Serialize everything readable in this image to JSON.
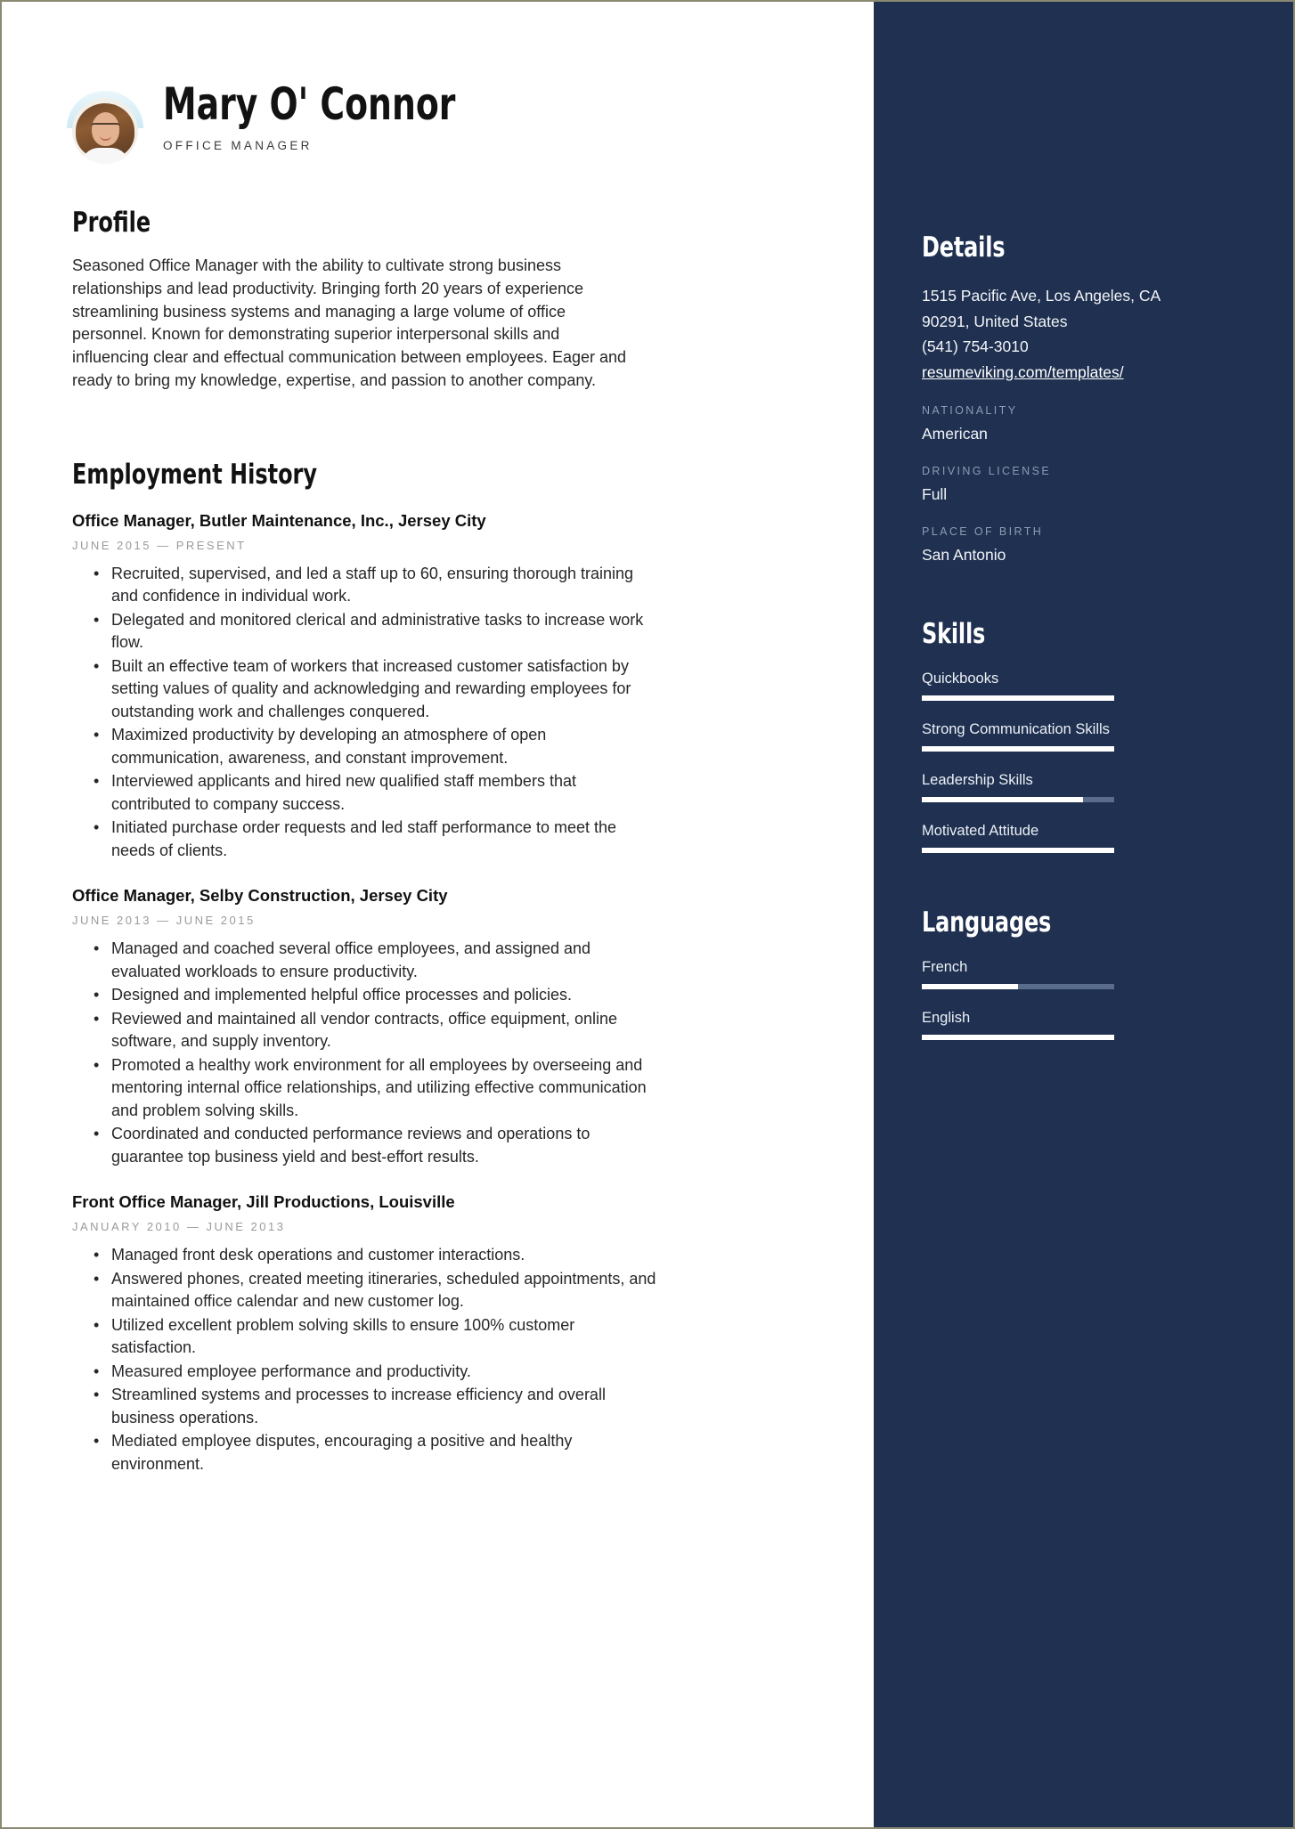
{
  "colors": {
    "sidebar_bg": "#1f3050",
    "accent_text": "#ffffff",
    "bar_track": "#5a6c8c",
    "muted_label": "#8d9bb3",
    "date_text": "#9a9a9a",
    "page_border": "#8a8a72"
  },
  "header": {
    "name": "Mary O' Connor",
    "role": "OFFICE MANAGER",
    "avatar_alt": "portrait-photo"
  },
  "profile": {
    "heading": "Profile",
    "text": "Seasoned Office Manager with the ability to cultivate strong business relationships and lead productivity. Bringing forth 20 years of experience streamlining business systems and managing a large volume of office personnel. Known for demonstrating superior interpersonal skills and influencing clear and effectual communication between employees.  Eager and ready to bring my knowledge, expertise, and passion to another company."
  },
  "employment": {
    "heading": "Employment History",
    "jobs": [
      {
        "title": "Office Manager, Butler Maintenance, Inc., Jersey City",
        "date": "JUNE 2015 — PRESENT",
        "bullets": [
          "Recruited, supervised, and led a staff up to 60, ensuring thorough training and confidence in individual work.",
          "Delegated and monitored clerical and administrative tasks to increase work flow.",
          "Built an effective team of workers that increased customer satisfaction by setting values of quality and acknowledging and rewarding employees for outstanding work and challenges conquered.",
          "Maximized productivity by developing an atmosphere of open communication, awareness, and constant improvement.",
          "Interviewed applicants and hired new qualified staff members that contributed to company success.",
          "Initiated purchase order requests and led staff performance to meet the needs of clients."
        ]
      },
      {
        "title": "Office Manager, Selby Construction, Jersey City",
        "date": "JUNE 2013 — JUNE 2015",
        "bullets": [
          "Managed and coached several office employees, and assigned and evaluated workloads to ensure productivity.",
          " Designed and implemented helpful office processes and policies.",
          "Reviewed and maintained all vendor contracts, office equipment, online software, and supply inventory.",
          "Promoted a healthy work environment for all employees by overseeing and mentoring internal office relationships, and utilizing effective communication and problem solving skills.",
          "Coordinated and conducted performance reviews and operations to guarantee top business yield and best-effort results."
        ]
      },
      {
        "title": "Front Office Manager, Jill Productions, Louisville",
        "date": "JANUARY 2010 — JUNE 2013",
        "bullets": [
          "Managed front desk operations and customer interactions.",
          "Answered phones, created meeting itineraries, scheduled appointments, and maintained office calendar and new customer log.",
          "Utilized excellent problem solving skills to ensure 100% customer satisfaction.",
          "Measured employee performance and productivity.",
          "Streamlined systems and processes to increase efficiency and overall business operations.",
          "Mediated employee disputes, encouraging a positive and healthy environment."
        ]
      }
    ]
  },
  "details": {
    "heading": "Details",
    "address_line1": "1515 Pacific Ave, Los Angeles, CA",
    "address_line2": "90291, United States",
    "phone": "(541) 754-3010",
    "website": "resumeviking.com/templates/",
    "fields": [
      {
        "label": "NATIONALITY",
        "value": "American"
      },
      {
        "label": "DRIVING LICENSE",
        "value": "Full"
      },
      {
        "label": "PLACE OF BIRTH",
        "value": "San Antonio"
      }
    ]
  },
  "skills": {
    "heading": "Skills",
    "items": [
      {
        "label": "Quickbooks",
        "level": 100
      },
      {
        "label": "Strong Communication Skills",
        "level": 100
      },
      {
        "label": "Leadership Skills",
        "level": 84
      },
      {
        "label": "Motivated Attitude",
        "level": 100
      }
    ]
  },
  "languages": {
    "heading": "Languages",
    "items": [
      {
        "label": "French",
        "level": 50
      },
      {
        "label": "English",
        "level": 100
      }
    ]
  }
}
